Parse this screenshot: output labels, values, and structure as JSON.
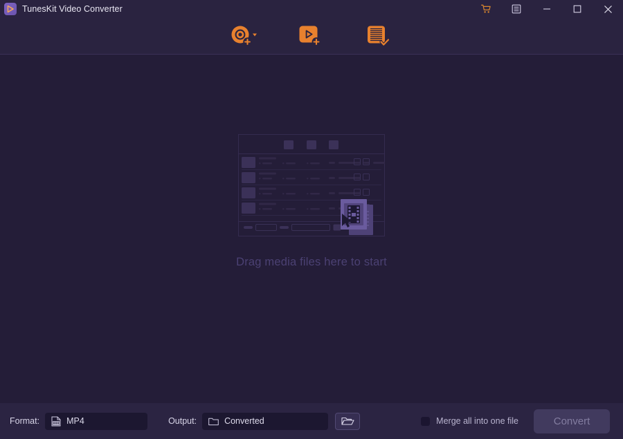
{
  "window": {
    "title": "TunesKit Video Converter",
    "app_icon": "play-triangle-icon",
    "controls": [
      {
        "name": "cart-button",
        "icon": "shopping-cart-icon",
        "label": ""
      },
      {
        "name": "menu-button",
        "icon": "hamburger-menu-icon",
        "label": ""
      },
      {
        "name": "minimize-button",
        "icon": "minimize-icon",
        "label": ""
      },
      {
        "name": "maximize-button",
        "icon": "maximize-icon",
        "label": ""
      },
      {
        "name": "close-button",
        "icon": "close-icon",
        "label": ""
      }
    ]
  },
  "toolbar": {
    "buttons": [
      {
        "name": "add-disc-button",
        "icon": "disc-add-icon",
        "has_dropdown": true,
        "label": ""
      },
      {
        "name": "add-video-button",
        "icon": "video-add-icon",
        "has_dropdown": false,
        "label": ""
      },
      {
        "name": "task-list-button",
        "icon": "document-check-icon",
        "has_dropdown": false,
        "label": ""
      }
    ]
  },
  "stage": {
    "placeholder_illustration": "app-window-wireframe-with-film-and-cursor",
    "drag_text": "Drag media files here to start"
  },
  "bottom": {
    "format_label": "Format:",
    "format_icon": "video-file-icon",
    "format_value": "MP4",
    "output_label": "Output:",
    "output_icon": "folder-icon",
    "output_value": "Converted",
    "browse_icon": "open-folder-icon",
    "merge_label": "Merge all into one file",
    "merge_checked": false,
    "convert_label": "Convert",
    "convert_enabled": false
  },
  "colors": {
    "window_bg": "#241d38",
    "chrome_bg": "#2a2340",
    "bottom_bg": "#2b2442",
    "accent_orange": "#e8812e",
    "accent_purple": "#6b54ad",
    "text_primary": "#e8e6f2",
    "text_muted": "#4b4173",
    "field_bg": "#1c1730",
    "convert_bg": "#413a5e"
  }
}
